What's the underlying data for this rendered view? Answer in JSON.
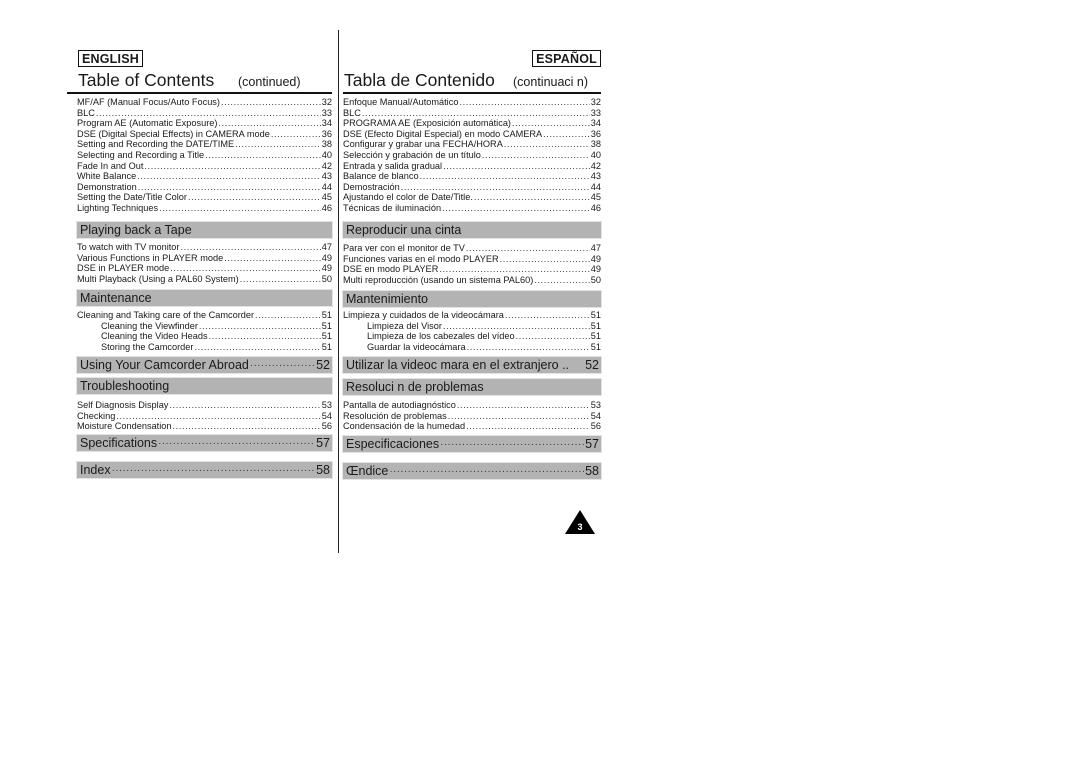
{
  "english": {
    "lang_label": "ENGLISH",
    "title": "Table of Contents",
    "subtitle": "(continued)",
    "camera_entries": [
      {
        "label": "MF/AF (Manual Focus/Auto Focus)",
        "page": "32"
      },
      {
        "label": "BLC",
        "page": "33"
      },
      {
        "label": "Program AE (Automatic Exposure)",
        "page": "34"
      },
      {
        "label": "DSE (Digital Special Effects) in CAMERA mode",
        "page": "36"
      },
      {
        "label": "Setting and Recording the DATE/TIME",
        "page": "38"
      },
      {
        "label": "Selecting and Recording a Title",
        "page": "40"
      },
      {
        "label": "Fade In and Out",
        "page": "42"
      },
      {
        "label": "White Balance",
        "page": "43"
      },
      {
        "label": "Demonstration",
        "page": "44"
      },
      {
        "label": "Setting the Date/Title Color",
        "page": "45"
      },
      {
        "label": "Lighting Techniques",
        "page": "46"
      }
    ],
    "playback": {
      "heading": "Playing back a Tape",
      "entries": [
        {
          "label": "To watch with TV monitor",
          "page": "47"
        },
        {
          "label": "Various Functions in PLAYER mode",
          "page": "49"
        },
        {
          "label": "DSE in PLAYER mode",
          "page": "49"
        },
        {
          "label": "Multi Playback (Using a PAL60 System)",
          "page": "50"
        }
      ]
    },
    "maintenance": {
      "heading": "Maintenance",
      "entries": [
        {
          "label": "Cleaning and Taking care of the Camcorder",
          "page": "51"
        },
        {
          "label": "Cleaning the Viewfinder",
          "page": "51"
        },
        {
          "label": "Cleaning the Video Heads",
          "page": "51"
        },
        {
          "label": "Storing the Camcorder",
          "page": "51"
        }
      ]
    },
    "abroad": {
      "heading": "Using Your Camcorder Abroad",
      "page": "52"
    },
    "troubleshooting": {
      "heading": "Troubleshooting",
      "entries": [
        {
          "label": "Self Diagnosis Display",
          "page": "53"
        },
        {
          "label": "Checking",
          "page": "54"
        },
        {
          "label": "Moisture Condensation",
          "page": "56"
        }
      ]
    },
    "specifications": {
      "heading": "Specifications",
      "page": "57"
    },
    "index": {
      "heading": "Index",
      "page": "58"
    }
  },
  "spanish": {
    "lang_label": "ESPAÑOL",
    "title": "Tabla de Contenido",
    "subtitle": "(continuaci n)",
    "camera_entries": [
      {
        "label": "Enfoque Manual/Automático",
        "page": "32"
      },
      {
        "label": "BLC",
        "page": "33"
      },
      {
        "label": "PROGRAMA AE (Exposición automática)",
        "page": "34"
      },
      {
        "label": "DSE (Efecto Digital Especial) en modo CAMERA",
        "page": "36"
      },
      {
        "label": "Configurar y grabar una FECHA/HORA",
        "page": "38"
      },
      {
        "label": "Selección y grabación de un título",
        "page": "40"
      },
      {
        "label": "Entrada y salida gradual",
        "page": "42"
      },
      {
        "label": "Balance de blanco",
        "page": "43"
      },
      {
        "label": "Demostración",
        "page": "44"
      },
      {
        "label": "Ajustando el color de Date/Title.",
        "page": "45"
      },
      {
        "label": "Técnicas de iluminación",
        "page": "46"
      }
    ],
    "playback": {
      "heading": "Reproducir una cinta",
      "entries": [
        {
          "label": "Para ver con el monitor de TV",
          "page": "47"
        },
        {
          "label": "Funciones varias en el modo PLAYER",
          "page": "49"
        },
        {
          "label": "DSE en modo PLAYER",
          "page": "49"
        },
        {
          "label": "Multi reproducción (usando un sistema PAL60)",
          "page": "50"
        }
      ]
    },
    "maintenance": {
      "heading": "Mantenimiento",
      "entries": [
        {
          "label": "Limpieza y cuidados de la videocámara",
          "page": "51"
        },
        {
          "label": "Limpieza del Visor",
          "page": "51"
        },
        {
          "label": "Limpieza de los cabezales del vídeo",
          "page": "51"
        },
        {
          "label": "Guardar la videocámara",
          "page": "51"
        }
      ]
    },
    "abroad": {
      "heading": "Utilizar la videoc mara en el extranjero ..",
      "page": "52"
    },
    "troubleshooting": {
      "heading": "Resoluci n de problemas",
      "entries": [
        {
          "label": "Pantalla de autodiagnóstico",
          "page": "53"
        },
        {
          "label": "Resolución de problemas",
          "page": "54"
        },
        {
          "label": "Condensación de la humedad",
          "page": "56"
        }
      ]
    },
    "specifications": {
      "heading": "Especificaciones",
      "page": "57"
    },
    "index": {
      "heading": "Œndice",
      "page": "58"
    }
  },
  "page_number": "3"
}
